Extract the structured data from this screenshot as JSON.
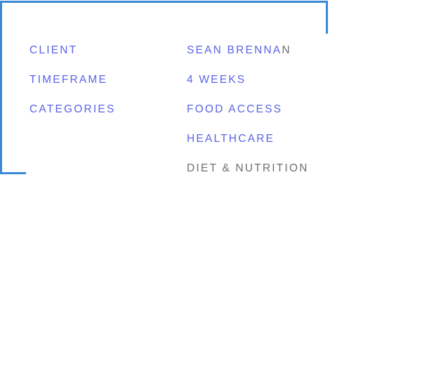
{
  "details": {
    "client_label": "CLIENT",
    "client_value_main": "SEAN BRENNA",
    "client_value_tail": "N",
    "timeframe_label": "TIMEFRAME",
    "timeframe_value": "4 WEEKS",
    "categories_label": "CATEGORIES",
    "categories": [
      "FOOD ACCESS",
      "HEALTHCARE",
      "DIET & NUTRITION"
    ]
  },
  "colors": {
    "frame": "#3b89d6",
    "accent_text": "#5b63e6",
    "muted_text": "#6f6f74",
    "background": "#ffffff"
  }
}
